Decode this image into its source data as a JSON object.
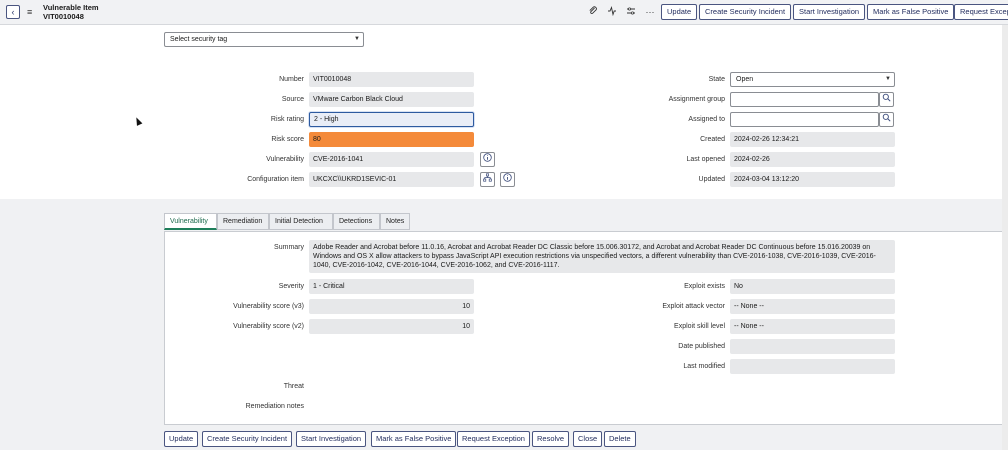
{
  "header": {
    "title": "Vulnerable Item",
    "record_number": "VIT0010048",
    "icons": [
      "paperclip-icon",
      "activity-icon",
      "settings-sliders-icon",
      "more-icon"
    ],
    "buttons": [
      "Update",
      "Create Security Incident",
      "Start Investigation",
      "Mark as False Positive",
      "Request Exception"
    ]
  },
  "security_tag": {
    "value": "Select security tag"
  },
  "form": {
    "number": {
      "label": "Number",
      "value": "VIT0010048"
    },
    "source": {
      "label": "Source",
      "value": "VMware Carbon Black Cloud"
    },
    "risk_rating": {
      "label": "Risk rating",
      "value": "2 - High"
    },
    "risk_score": {
      "label": "Risk score",
      "value": "80"
    },
    "vulnerability": {
      "label": "Vulnerability",
      "value": "CVE-2016-1041"
    },
    "configuration_item": {
      "label": "Configuration item",
      "value": "UKCXC\\\\UKRD1SEVIC-01"
    },
    "state": {
      "label": "State",
      "value": "Open"
    },
    "assignment_group": {
      "label": "Assignment group",
      "value": ""
    },
    "assigned_to": {
      "label": "Assigned to",
      "value": ""
    },
    "created": {
      "label": "Created",
      "value": "2024-02-26 12:34:21"
    },
    "last_opened": {
      "label": "Last opened",
      "value": "2024-02-26"
    },
    "updated": {
      "label": "Updated",
      "value": "2024-03-04 13:12:20"
    }
  },
  "tabs": [
    "Vulnerability",
    "Remediation",
    "Initial Detection",
    "Detections",
    "Notes"
  ],
  "details": {
    "summary": {
      "label": "Summary",
      "value": "Adobe Reader and Acrobat before 11.0.16, Acrobat and Acrobat Reader DC Classic before 15.006.30172, and Acrobat and Acrobat Reader DC Continuous before 15.016.20039 on Windows and OS X allow attackers to bypass JavaScript API execution restrictions via unspecified vectors, a different vulnerability than CVE-2016-1038, CVE-2016-1039, CVE-2016-1040, CVE-2016-1042, CVE-2016-1044, CVE-2016-1062, and CVE-2016-1117."
    },
    "severity": {
      "label": "Severity",
      "value": "1 - Critical"
    },
    "vuln_score_v3": {
      "label": "Vulnerability score (v3)",
      "value": "10"
    },
    "vuln_score_v2": {
      "label": "Vulnerability score (v2)",
      "value": "10"
    },
    "threat": {
      "label": "Threat"
    },
    "remediation_notes": {
      "label": "Remediation notes"
    },
    "exploit_exists": {
      "label": "Exploit exists",
      "value": "No"
    },
    "exploit_attack_vector": {
      "label": "Exploit attack vector",
      "value": "-- None --"
    },
    "exploit_skill_level": {
      "label": "Exploit skill level",
      "value": "-- None --"
    },
    "date_published": {
      "label": "Date published",
      "value": ""
    },
    "last_modified": {
      "label": "Last modified",
      "value": ""
    }
  },
  "bottom_buttons": [
    "Update",
    "Create Security Incident",
    "Start Investigation",
    "Mark as False Positive",
    "Request Exception",
    "Resolve",
    "Close",
    "Delete"
  ],
  "colors": {
    "accent": "#1f2a5c",
    "risk_score": "#f48a3a",
    "tab_active": "#1e7e5a"
  }
}
